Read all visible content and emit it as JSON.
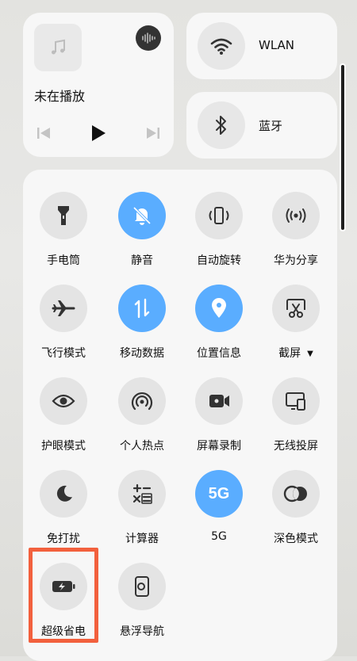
{
  "media": {
    "title": "未在播放"
  },
  "wlan": {
    "label": "WLAN"
  },
  "bluetooth": {
    "label": "蓝牙"
  },
  "toggles": [
    {
      "label": "手电筒",
      "icon": "flashlight-icon",
      "active": false
    },
    {
      "label": "静音",
      "icon": "mute-bell-icon",
      "active": true
    },
    {
      "label": "自动旋转",
      "icon": "auto-rotate-icon",
      "active": false
    },
    {
      "label": "华为分享",
      "icon": "share-wireless-icon",
      "active": false
    },
    {
      "label": "飞行模式",
      "icon": "airplane-icon",
      "active": false
    },
    {
      "label": "移动数据",
      "icon": "mobile-data-icon",
      "active": true
    },
    {
      "label": "位置信息",
      "icon": "location-pin-icon",
      "active": true
    },
    {
      "label": "截屏",
      "icon": "scissors-icon",
      "active": false,
      "has_dropdown": true
    },
    {
      "label": "护眼模式",
      "icon": "eye-icon",
      "active": false
    },
    {
      "label": "个人热点",
      "icon": "hotspot-icon",
      "active": false
    },
    {
      "label": "屏幕录制",
      "icon": "video-camera-icon",
      "active": false
    },
    {
      "label": "无线投屏",
      "icon": "cast-screen-icon",
      "active": false
    },
    {
      "label": "免打扰",
      "icon": "moon-icon",
      "active": false
    },
    {
      "label": "计算器",
      "icon": "calculator-icon",
      "active": false
    },
    {
      "label": "5G",
      "icon": "5g-icon",
      "active": true,
      "icon_text": "5G"
    },
    {
      "label": "深色模式",
      "icon": "dark-mode-icon",
      "active": false
    },
    {
      "label": "超级省电",
      "icon": "battery-saver-icon",
      "active": false,
      "highlighted": true
    },
    {
      "label": "悬浮导航",
      "icon": "float-nav-icon",
      "active": false
    }
  ],
  "colors": {
    "accent": "#5aadff",
    "highlight": "#f2603d",
    "tile_bg": "#e4e4e4",
    "card_bg": "#f7f7f7"
  }
}
